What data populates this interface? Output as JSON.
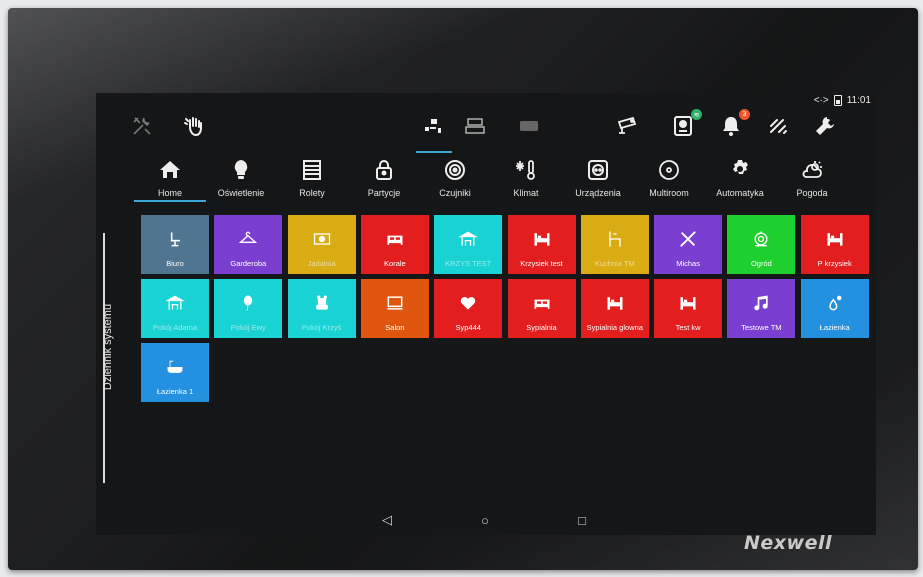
{
  "status": {
    "time": "11:01",
    "signal_glyph": "<·>"
  },
  "brand": "Nexwell",
  "side_tab": {
    "label": "Dziennik systemu"
  },
  "topbar": {
    "left_icons": [
      "tools-icon",
      "hand-icon"
    ],
    "view_icons": [
      "rooms-view-icon",
      "floors-view-icon",
      "tablet-view-icon"
    ],
    "right_icons": [
      {
        "name": "camera-icon"
      },
      {
        "name": "intercom-icon",
        "badge_color": "#2db36b"
      },
      {
        "name": "bell-icon",
        "badge": "3",
        "badge_color": "#f0562a"
      },
      {
        "name": "wireless-icon"
      },
      {
        "name": "wrench-icon"
      }
    ]
  },
  "categories": [
    {
      "label": "Home",
      "icon": "home-icon",
      "active": true
    },
    {
      "label": "Oświetlenie",
      "icon": "lightbulb-icon"
    },
    {
      "label": "Rolety",
      "icon": "blinds-icon"
    },
    {
      "label": "Partycje",
      "icon": "lock-icon"
    },
    {
      "label": "Czujniki",
      "icon": "sensor-icon"
    },
    {
      "label": "Klimat",
      "icon": "climate-icon"
    },
    {
      "label": "Urządzenia",
      "icon": "socket-icon"
    },
    {
      "label": "Multiroom",
      "icon": "disc-icon"
    },
    {
      "label": "Automatyka",
      "icon": "gear-icon"
    },
    {
      "label": "Pogoda",
      "icon": "weather-icon"
    }
  ],
  "tiles": [
    {
      "label": "Biuro",
      "color": "#4f7590",
      "icon": "chair-icon"
    },
    {
      "label": "Garderoba",
      "color": "#7a3fd0",
      "icon": "hanger-icon"
    },
    {
      "label": "Jadalnia",
      "color": "#d8ac12",
      "icon": "dining-icon",
      "dim": true
    },
    {
      "label": "Korale",
      "color": "#e21e1e",
      "icon": "bed-double-icon"
    },
    {
      "label": "KRZYS TEST",
      "color": "#19d2d4",
      "icon": "playground-icon",
      "dim": true
    },
    {
      "label": "Krzysiek test",
      "color": "#e21e1e",
      "icon": "bed-icon"
    },
    {
      "label": "Kuchnia TM",
      "color": "#d8ac12",
      "icon": "kitchen-icon",
      "dim": true
    },
    {
      "label": "Michas",
      "color": "#7a3fd0",
      "icon": "tools-icon"
    },
    {
      "label": "Ogród",
      "color": "#1fcf2e",
      "icon": "hose-icon"
    },
    {
      "label": "P krzysiek",
      "color": "#e21e1e",
      "icon": "bed-icon"
    },
    {
      "label": "Pokój Adama",
      "color": "#19d2d4",
      "icon": "playground-icon",
      "dim": true
    },
    {
      "label": "Pokój Ewy",
      "color": "#19d2d4",
      "icon": "balloon-icon",
      "dim": true
    },
    {
      "label": "Pokój Krzyś",
      "color": "#19d2d4",
      "icon": "toy-icon",
      "dim": true
    },
    {
      "label": "Salon",
      "color": "#e0560f",
      "icon": "tv-icon"
    },
    {
      "label": "Syp444",
      "color": "#e21e1e",
      "icon": "heart-icon"
    },
    {
      "label": "Sypialnia",
      "color": "#e21e1e",
      "icon": "bed-double-icon"
    },
    {
      "label": "Sypialnia glowna",
      "color": "#e21e1e",
      "icon": "bed-icon"
    },
    {
      "label": "Test kw",
      "color": "#e21e1e",
      "icon": "bed-icon"
    },
    {
      "label": "Testowe TM",
      "color": "#7a3fd0",
      "icon": "music-icon"
    },
    {
      "label": "Łazienka",
      "color": "#2490e0",
      "icon": "drops-icon"
    },
    {
      "label": "Łazienka 1",
      "color": "#2490e0",
      "icon": "bathtub-icon"
    }
  ],
  "nav": [
    "back-icon",
    "home-circle-icon",
    "recents-icon"
  ]
}
